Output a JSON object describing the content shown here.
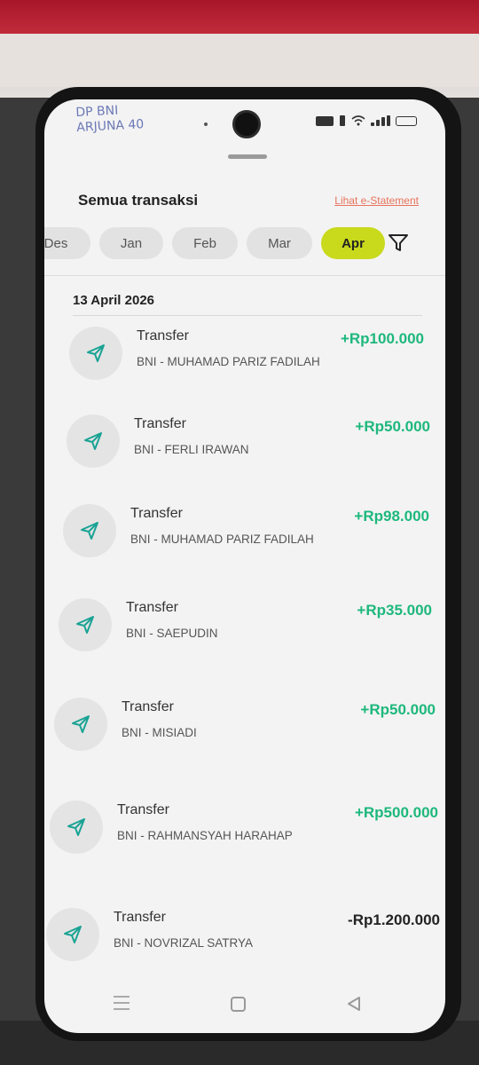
{
  "status": {
    "sticker_line1": "DP BNI",
    "sticker_line2": "ARJUNA 40"
  },
  "header": {
    "title": "Semua transaksi",
    "estatement_link": "Lihat e-Statement"
  },
  "months": [
    {
      "label": "Des",
      "active": false
    },
    {
      "label": "Jan",
      "active": false
    },
    {
      "label": "Feb",
      "active": false
    },
    {
      "label": "Mar",
      "active": false
    },
    {
      "label": "Apr",
      "active": true
    }
  ],
  "date_group": "13 April 2026",
  "transactions": [
    {
      "type": "Transfer",
      "name": "BNI - MUHAMAD PARIZ FADILAH",
      "amount": "+Rp100.000",
      "direction": "in"
    },
    {
      "type": "Transfer",
      "name": "BNI - FERLI IRAWAN",
      "amount": "+Rp50.000",
      "direction": "in"
    },
    {
      "type": "Transfer",
      "name": "BNI - MUHAMAD PARIZ FADILAH",
      "amount": "+Rp98.000",
      "direction": "in"
    },
    {
      "type": "Transfer",
      "name": "BNI - SAEPUDIN",
      "amount": "+Rp35.000",
      "direction": "in"
    },
    {
      "type": "Transfer",
      "name": "BNI - MISIADI",
      "amount": "+Rp50.000",
      "direction": "in"
    },
    {
      "type": "Transfer",
      "name": "BNI - RAHMANSYAH HARAHAP",
      "amount": "+Rp500.000",
      "direction": "in"
    },
    {
      "type": "Transfer",
      "name": "BNI - NOVRIZAL SATRYA",
      "amount": "-Rp1.200.000",
      "direction": "out"
    }
  ],
  "colors": {
    "incoming": "#1db87c",
    "outgoing": "#222222",
    "accent_chip": "#c9d91c",
    "icon_teal": "#1aa394",
    "link": "#e8735c"
  },
  "icons": {
    "transaction": "paper-plane-icon",
    "filter": "filter-funnel-icon"
  }
}
